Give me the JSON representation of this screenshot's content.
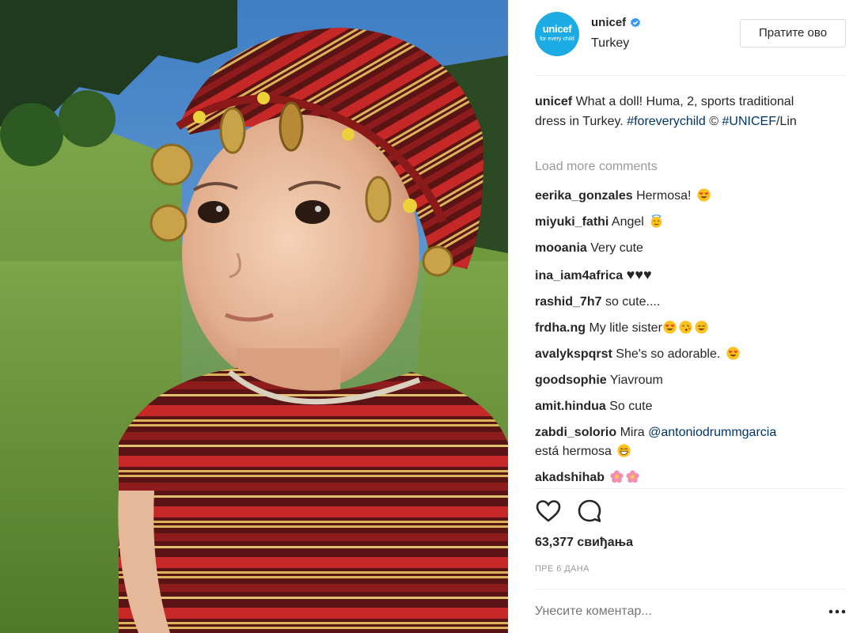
{
  "post": {
    "account": {
      "username": "unicef",
      "location": "Turkey",
      "verified": true,
      "avatar_logo": "unicef",
      "avatar_tagline": "for every child",
      "brand_color": "#1cabe2"
    },
    "follow_label": "Пратите ово",
    "caption": {
      "username": "unicef",
      "text": "What a doll! Huma, 2, sports traditional dress in Turkey.",
      "hashtag": "#foreverychild",
      "copyright": "©",
      "credit_tag": "#UNICEF",
      "credit_rest": "/Lin"
    },
    "load_more": "Load more comments",
    "comments": [
      {
        "user": "eerika_gonzales",
        "text": "Hermosa!",
        "emoji": [
          "heart-eyes"
        ]
      },
      {
        "user": "miyuki_fathi",
        "text": "Angel",
        "emoji": [
          "angel"
        ]
      },
      {
        "user": "mooania",
        "text": "Very cute",
        "emoji": []
      },
      {
        "user": "ina_iam4africa",
        "text": "♥♥♥",
        "emoji": []
      },
      {
        "user": "rashid_7h7",
        "text": "so cute....",
        "emoji": []
      },
      {
        "user": "frdha.ng",
        "text": "My litle sister",
        "emoji": [
          "heart-eyes",
          "kiss",
          "sweat-smile"
        ]
      },
      {
        "user": "avalykspqrst",
        "text": "She's so adorable.",
        "emoji": [
          "heart-eyes"
        ]
      },
      {
        "user": "goodsophie",
        "text": "Yiavroum",
        "emoji": []
      },
      {
        "user": "amit.hindua",
        "text": "So cute",
        "emoji": []
      },
      {
        "user": "zabdi_solorio",
        "text": "Mira",
        "mention": "@antoniodrummgarcia",
        "text2": "está hermosa",
        "emoji": [
          "grin"
        ]
      },
      {
        "user": "akadshihab",
        "text": "",
        "emoji": [
          "blossom",
          "blossom"
        ]
      }
    ],
    "actions": {
      "like_icon": "heart-icon",
      "comment_icon": "comment-bubble-icon"
    },
    "likes": "63,377 свиђања",
    "timestamp": "ПРЕ 6 ДАНА",
    "comment_placeholder": "Унесите коментар...",
    "more_icon": "ellipsis-icon",
    "colors": {
      "link": "#003569",
      "muted": "#999999",
      "text": "#262626",
      "verified": "#3897f0"
    }
  }
}
